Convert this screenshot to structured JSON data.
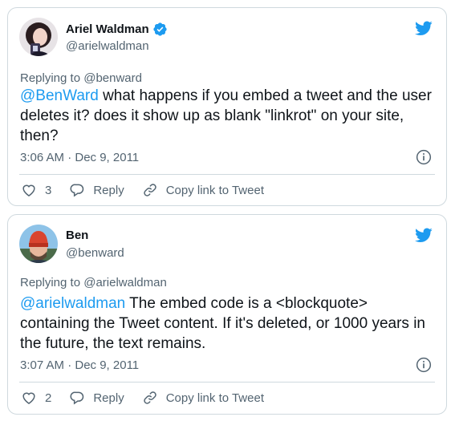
{
  "colors": {
    "accent": "#1d9bf0",
    "text": "#0f1419",
    "muted": "#536471",
    "border": "#cfd9de"
  },
  "tweets": [
    {
      "author": {
        "name": "Ariel Waldman",
        "handle": "@arielwaldman",
        "verified": true,
        "verified_icon": "verified-badge-icon"
      },
      "replying_to": "Replying to @benward",
      "mention": "@BenWard",
      "text": " what happens if you embed a tweet and the user deletes it? does it show up as blank \"linkrot\" on your site, then?",
      "timestamp": "3:06 AM · Dec 9, 2011",
      "actions": {
        "likes": "3",
        "reply_label": "Reply",
        "copy_label": "Copy link to Tweet"
      }
    },
    {
      "author": {
        "name": "Ben",
        "handle": "@benward",
        "verified": false
      },
      "replying_to": "Replying to @arielwaldman",
      "mention": "@arielwaldman",
      "text": " The embed code is a <blockquote> containing the Tweet content. If it's deleted, or 1000 years in the future, the text remains.",
      "timestamp": "3:07 AM · Dec 9, 2011",
      "actions": {
        "likes": "2",
        "reply_label": "Reply",
        "copy_label": "Copy link to Tweet"
      }
    }
  ]
}
